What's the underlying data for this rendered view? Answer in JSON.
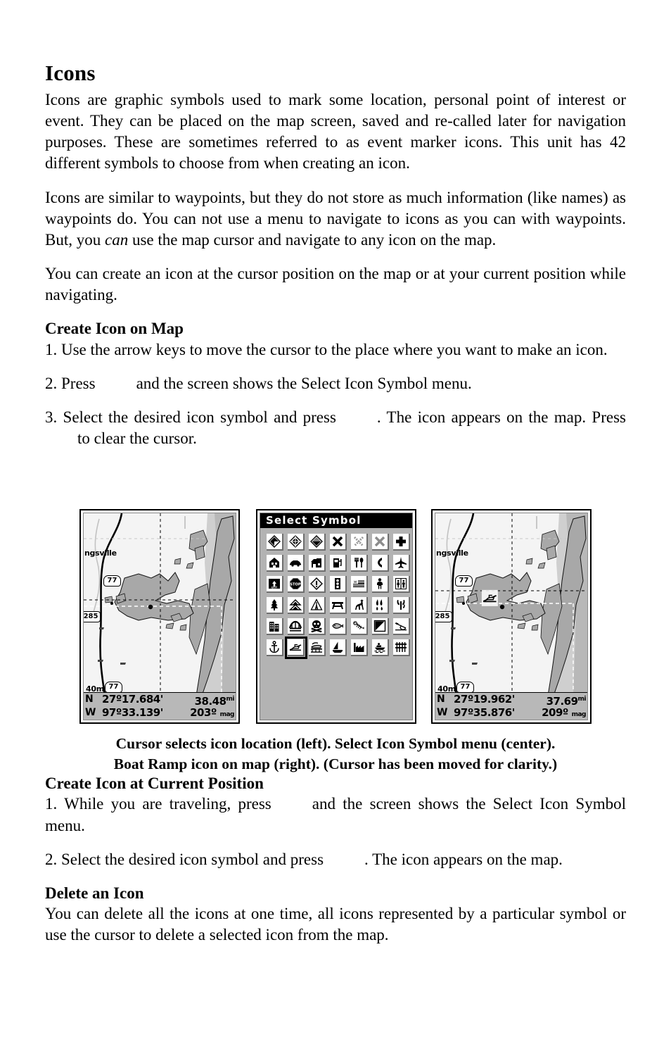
{
  "document": {
    "title": "Icons",
    "paragraphs": [
      "Icons are graphic symbols used to mark some location, personal point of interest or event. They can be placed on the map screen, saved and re-called later for navigation purposes. These are sometimes referred to as event marker icons. This unit has 42 different symbols to choose from when creating an icon.",
      "You can create an icon at the cursor position on the map or at your current position while navigating."
    ],
    "para2": {
      "before_italic": "Icons are similar to waypoints, but they do not store as much information (like names) as waypoints do. You can not use a menu to navigate to icons as you can with waypoints. But, you ",
      "italic": "can",
      "after_italic": " use the map cursor and navigate to any icon on the map."
    },
    "sections": [
      {
        "heading": "Create Icon on Map",
        "steps": [
          {
            "text_a": "1. Use the arrow keys to move the cursor to the place where you want to make an icon."
          },
          {
            "text_a": "2. Press",
            "text_b": "and the screen shows the Select Icon Symbol menu."
          },
          {
            "text_a": "3. Select the desired icon symbol and press",
            "text_b": ". The icon appears on the map. Press",
            "text_c": "to clear the cursor."
          }
        ]
      },
      {
        "heading": "Create Icon at Current Position",
        "steps": [
          {
            "text_a": "1. While you are traveling, press",
            "text_b": "and the screen shows the Select Icon Symbol menu."
          },
          {
            "text_a": "2. Select the desired icon symbol and press",
            "text_b": ". The icon appears on the map."
          }
        ]
      },
      {
        "heading": "Delete an Icon",
        "steps": [
          {
            "text_a": "You can delete all the icons at one time, all icons represented by a particular symbol or use the cursor to delete a selected icon from the map."
          }
        ]
      }
    ],
    "figure_caption_line1": "Cursor selects icon location (left). Select Icon Symbol menu (center).",
    "figure_caption_line2": "Boat Ramp icon on map (right). (Cursor has been moved for clarity.)"
  },
  "figure": {
    "left_screen": {
      "city_label": "ngsville",
      "scale_label": "40mi",
      "route_shield_upper": "77",
      "route_shield_lower": "77",
      "route_shield_side": "285",
      "status": {
        "lat_hemisphere": "N",
        "latitude": "27º17.684'",
        "lon_hemisphere": "W",
        "longitude": "97º33.139'",
        "distance": "38.48",
        "distance_unit": "mi",
        "bearing": "203º",
        "bearing_unit": "mag"
      }
    },
    "symbol_menu": {
      "title": "Select Symbol",
      "selected_index": 36,
      "selected_name": "boat-ramp",
      "icons": [
        "diamond-filled",
        "diamond-outline",
        "diamond-half",
        "x-bold",
        "x-dotted",
        "x-gray",
        "medical-cross",
        "house",
        "car",
        "store",
        "fuel-pump",
        "restaurant",
        "telephone",
        "airport",
        "exit-sign",
        "stop-sign",
        "caution-diamond",
        "traffic-light",
        "flag",
        "pedestrian",
        "restrooms",
        "tree",
        "mountains",
        "tent",
        "picnic-table",
        "deer",
        "campfire",
        "cactus",
        "building",
        "bridge",
        "danger-skull",
        "fish",
        "fish-bones",
        "diagonal-square",
        "fish-hook",
        "anchor",
        "boat-ramp",
        "dock",
        "sailboat",
        "factory",
        "motorboat",
        "pier"
      ]
    },
    "right_screen": {
      "city_label": "ngsville",
      "scale_label": "40mi",
      "route_shield_upper": "77",
      "route_shield_lower": "77",
      "route_shield_side": "285",
      "status": {
        "lat_hemisphere": "N",
        "latitude": "27º19.962'",
        "lon_hemisphere": "W",
        "longitude": "97º35.876'",
        "distance": "37.69",
        "distance_unit": "mi",
        "bearing": "209º",
        "bearing_unit": "mag"
      }
    }
  },
  "colors": {
    "panel_gray": "#b3b3b3",
    "status_gray": "#b8b8b8",
    "land_gray": "#a8a8a8",
    "water_light": "#f4f4f4",
    "shallow_gray": "#cfcfcf"
  }
}
